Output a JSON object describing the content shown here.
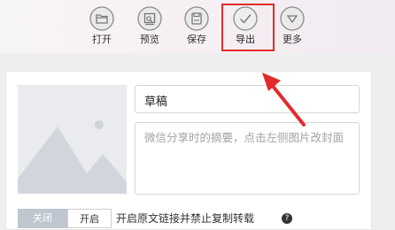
{
  "toolbar": {
    "items": [
      {
        "label": "打开",
        "icon": "folder-icon"
      },
      {
        "label": "预览",
        "icon": "preview-icon"
      },
      {
        "label": "保存",
        "icon": "save-icon"
      },
      {
        "label": "导出",
        "icon": "checkmark-icon"
      },
      {
        "label": "更多",
        "icon": "chevron-down-icon"
      }
    ],
    "highlighted_item": "导出",
    "highlight_color": "#e12b2b"
  },
  "editor": {
    "title_value": "草稿",
    "digest_placeholder": "微信分享时的摘要，点击左侧图片改封面",
    "cover_icon": "image-placeholder-icon",
    "toggle": {
      "off_label": "关闭",
      "on_label": "开启"
    },
    "toggle_description": "开启原文链接并禁止复制转载"
  }
}
